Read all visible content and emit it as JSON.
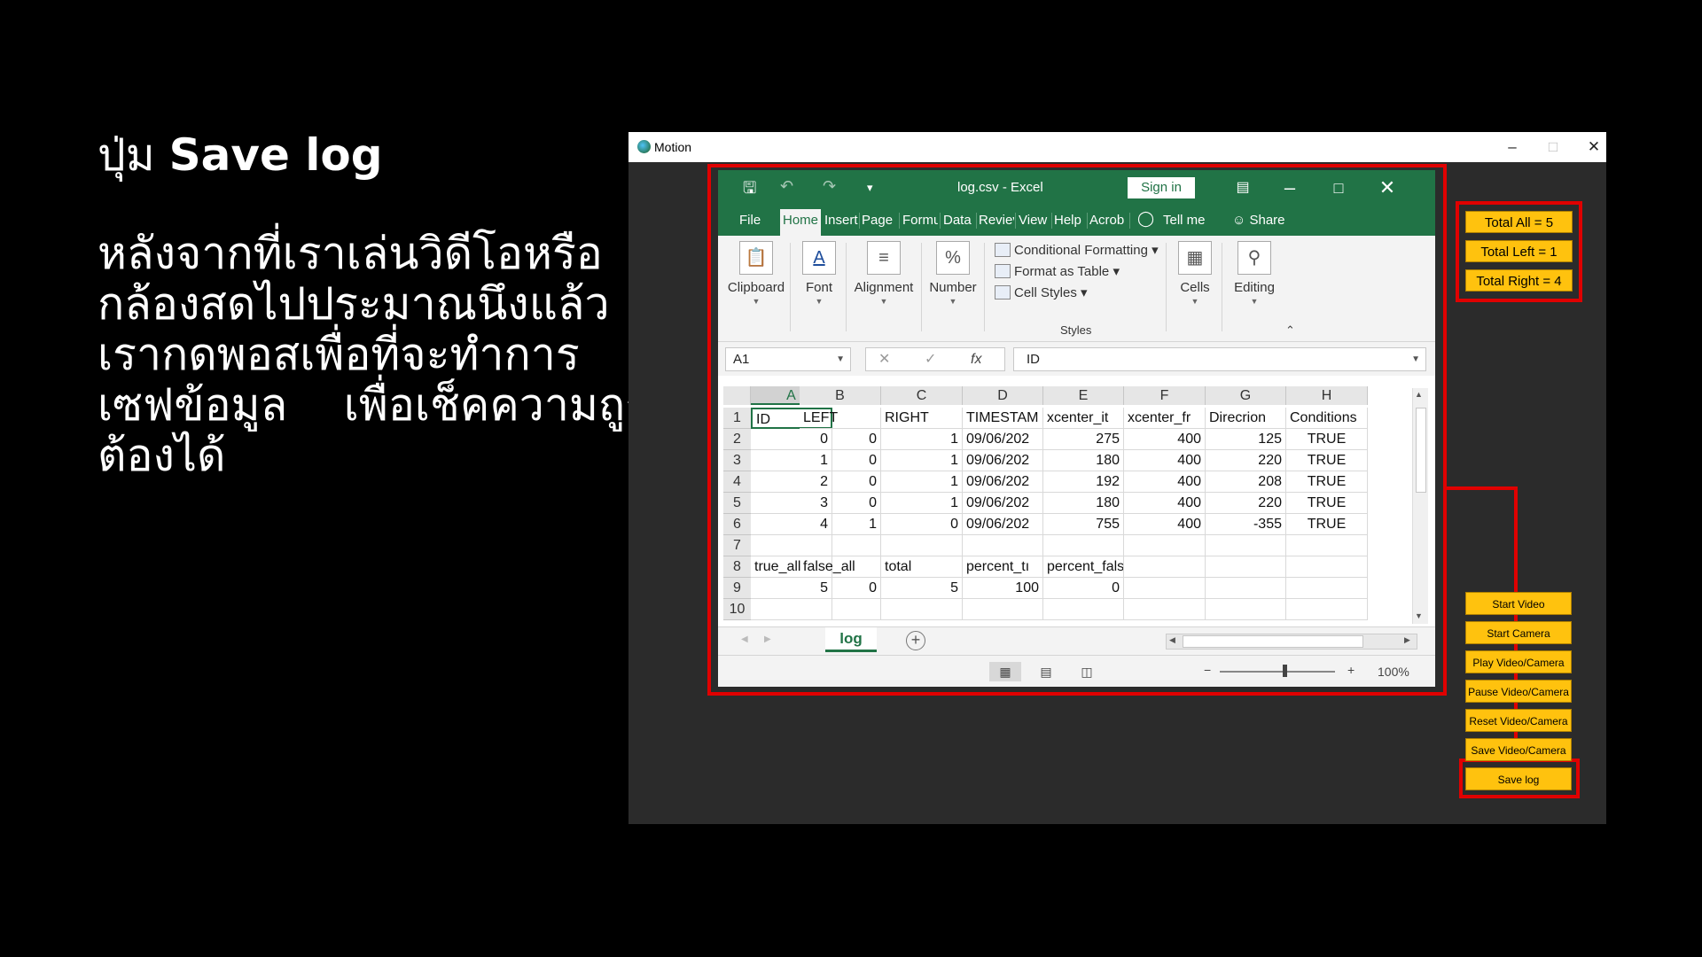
{
  "slide": {
    "title_prefix": "ปุ่ม",
    "title_bold": "Save log",
    "body_lines": [
      "หลังจากที่เราเล่นวิดีโอหรือ",
      "กล้องสดไปประมาณนึงแล้ว",
      "เรากดพอสเพื่อที่จะทำการ",
      "เซฟข้อมูล    เพื่อเช็คความถูก",
      "ต้องได้"
    ]
  },
  "motion": {
    "title": "Motion",
    "totals": [
      "Total All = 5",
      "Total Left = 1",
      "Total Right = 4"
    ],
    "buttons": [
      "Start Video",
      "Start Camera",
      "Play Video/Camera",
      "Pause Video/Camera",
      "Reset Video/Camera",
      "Save Video/Camera",
      "Save log"
    ]
  },
  "excel": {
    "title": "log.csv  -  Excel",
    "sign_in": "Sign in",
    "tabs": [
      "File",
      "Home",
      "Insert",
      "Page l",
      "Formu",
      "Data",
      "Reviev",
      "View",
      "Help",
      "Acrob",
      "Tell me",
      "Share"
    ],
    "ribbon": {
      "clipboard": "Clipboard",
      "font": "Font",
      "alignment": "Alignment",
      "number": "Number",
      "conditional_formatting": "Conditional Formatting",
      "format_as_table": "Format as Table",
      "cell_styles": "Cell Styles",
      "styles": "Styles",
      "cells": "Cells",
      "editing": "Editing"
    },
    "name_box": "A1",
    "formula": "ID",
    "columns": [
      "A",
      "B",
      "C",
      "D",
      "E",
      "F",
      "G",
      "H"
    ],
    "rows": [
      [
        "ID",
        "LEFT",
        "RIGHT",
        "TIMESTAM",
        "xcenter_it",
        "xcenter_fr",
        "Direcrion",
        "Conditions"
      ],
      [
        "0",
        "0",
        "1",
        "09/06/202",
        "275",
        "400",
        "125",
        "TRUE"
      ],
      [
        "1",
        "0",
        "1",
        "09/06/202",
        "180",
        "400",
        "220",
        "TRUE"
      ],
      [
        "2",
        "0",
        "1",
        "09/06/202",
        "192",
        "400",
        "208",
        "TRUE"
      ],
      [
        "3",
        "0",
        "1",
        "09/06/202",
        "180",
        "400",
        "220",
        "TRUE"
      ],
      [
        "4",
        "1",
        "0",
        "09/06/202",
        "755",
        "400",
        "-355",
        "TRUE"
      ],
      [
        "",
        "",
        "",
        "",
        "",
        "",
        "",
        ""
      ],
      [
        "true_all",
        "false_all",
        "total",
        "percent_tı",
        "percent_false",
        "",
        "",
        ""
      ],
      [
        "5",
        "0",
        "5",
        "100",
        "0",
        "",
        "",
        ""
      ],
      [
        "",
        "",
        "",
        "",
        "",
        "",
        "",
        ""
      ]
    ],
    "row_numbers": [
      "1",
      "2",
      "3",
      "4",
      "5",
      "6",
      "7",
      "8",
      "9",
      "10"
    ],
    "sheet_tab": "log",
    "zoom": "100%"
  },
  "colors": {
    "excel_green": "#217346",
    "highlight_red": "#e00000",
    "button_yellow": "#ffc20e"
  }
}
